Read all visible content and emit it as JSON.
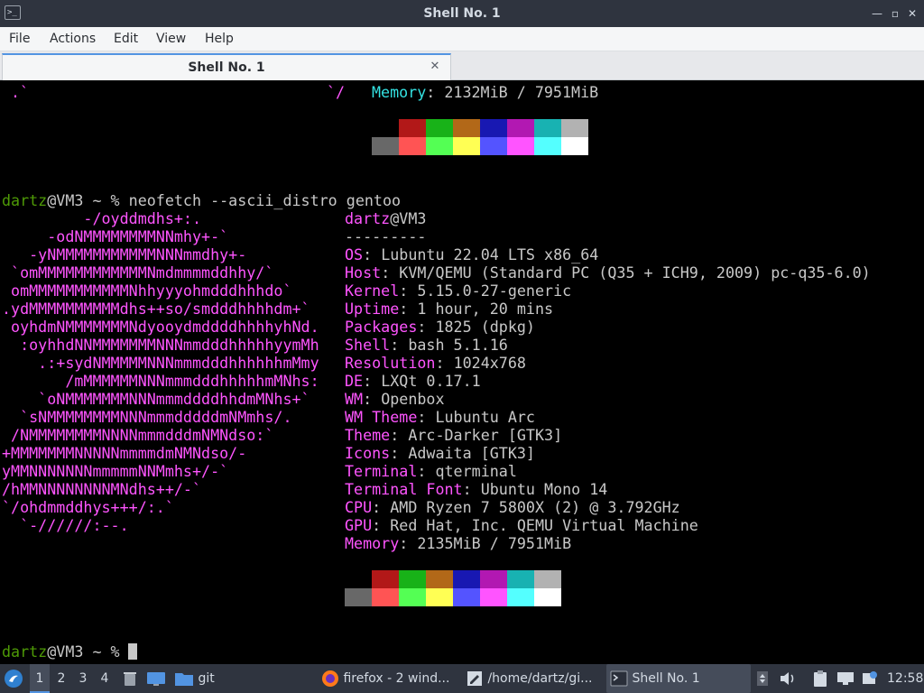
{
  "window": {
    "title": "Shell No. 1",
    "controls": {
      "minimize": "—",
      "maximize": "▫",
      "close": "✕"
    }
  },
  "menu": [
    "File",
    "Actions",
    "Edit",
    "View",
    "Help"
  ],
  "tab": {
    "label": "Shell No. 1",
    "close": "✕"
  },
  "terminal": {
    "prev": {
      "art": ".`",
      "art2": "`/",
      "key": "Memory",
      "val": ": 2132MiB / 7951MiB"
    },
    "prompt": {
      "user": "dartz",
      "host": "@VM3",
      "rest": " ~ % "
    },
    "command": "neofetch --ascii_distro gentoo",
    "ascii": [
      "         -/oyddmdhs+:.",
      "     -odNMMMMMMMMNNmhy+-`",
      "   -yNMMMMMMMMMMMNNNmmdhy+-",
      " `omMMMMMMMMMMMMNmdmmmmddhhy/`",
      " omMMMMMMMMMMMNhhyyyohmdddhhhdo`",
      ".ydMMMMMMMMMMdhs++so/smdddhhhhdm+`",
      " oyhdmNMMMMMMMNdyooydmddddhhhhyhNd.",
      "  :oyhhdNNMMMMMMMNNNmmdddhhhhhyymMh",
      "    .:+sydNMMMMMNNNmmmdddhhhhhhmMmy",
      "       /mMMMMMMNNNmmmdddhhhhhmMNhs:",
      "    `oNMMMMMMMNNNmmmddddhhdmMNhs+`",
      "  `sNMMMMMMMMNNNmmmdddddmNMmhs/.",
      " /NMMMMMMMMNNNNmmmdddmNMNdso:`",
      "+MMMMMMMNNNNNmmmmdmNMNdso/-",
      "yMMNNNNNNNmmmmmNNMmhs+/-`",
      "/hMMNNNNNNNNMNdhs++/-`",
      "`/ohdmmddhys+++/:.`",
      "  `-//////:--."
    ],
    "info_title": {
      "user": "dartz",
      "at_host": "@VM3",
      "separator": "---------"
    },
    "info": [
      {
        "key": "OS",
        "val": "Lubuntu 22.04 LTS x86_64"
      },
      {
        "key": "Host",
        "val": "KVM/QEMU (Standard PC (Q35 + ICH9, 2009) pc-q35-6.0)"
      },
      {
        "key": "Kernel",
        "val": "5.15.0-27-generic"
      },
      {
        "key": "Uptime",
        "val": "1 hour, 20 mins"
      },
      {
        "key": "Packages",
        "val": "1825 (dpkg)"
      },
      {
        "key": "Shell",
        "val": "bash 5.1.16"
      },
      {
        "key": "Resolution",
        "val": "1024x768"
      },
      {
        "key": "DE",
        "val": "LXQt 0.17.1"
      },
      {
        "key": "WM",
        "val": "Openbox"
      },
      {
        "key": "WM Theme",
        "val": "Lubuntu Arc"
      },
      {
        "key": "Theme",
        "val": "Arc-Darker [GTK3]"
      },
      {
        "key": "Icons",
        "val": "Adwaita [GTK3]"
      },
      {
        "key": "Terminal",
        "val": "qterminal"
      },
      {
        "key": "Terminal Font",
        "val": "Ubuntu Mono 14"
      },
      {
        "key": "CPU",
        "val": "AMD Ryzen 7 5800X (2) @ 3.792GHz"
      },
      {
        "key": "GPU",
        "val": "Red Hat, Inc. QEMU Virtual Machine"
      },
      {
        "key": "Memory",
        "val": "2135MiB / 7951MiB"
      }
    ],
    "palette_top": [
      "#000000",
      "#b21818",
      "#18b218",
      "#b26818",
      "#1818b2",
      "#b218b2",
      "#18b2b2",
      "#b2b2b2"
    ],
    "palette_bottom": [
      "#686868",
      "#ff5454",
      "#54ff54",
      "#ffff54",
      "#5454ff",
      "#ff54ff",
      "#54ffff",
      "#ffffff"
    ]
  },
  "taskbar": {
    "workspaces": [
      "1",
      "2",
      "3",
      "4"
    ],
    "folder_label": "git",
    "tasks": [
      {
        "label": "firefox - 2 wind...",
        "icon": "firefox-icon"
      },
      {
        "label": "/home/dartz/gi...",
        "icon": "text-editor-icon"
      },
      {
        "label": "Shell No. 1",
        "icon": "terminal-icon"
      }
    ],
    "clock": "12:58"
  }
}
